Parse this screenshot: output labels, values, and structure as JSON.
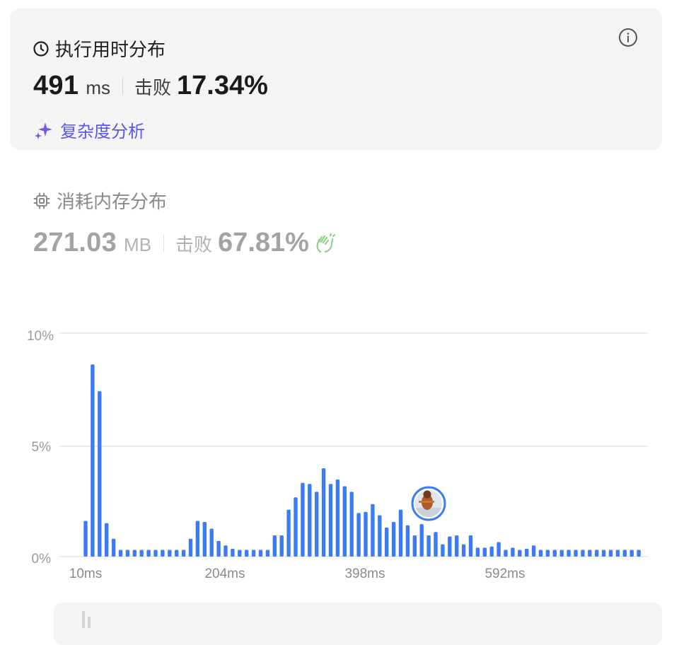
{
  "runtime": {
    "title": "执行用时分布",
    "value": "491",
    "unit": "ms",
    "beat_label": "击败",
    "beat_value": "17.34%",
    "complexity_link": "复杂度分析"
  },
  "memory": {
    "title": "消耗内存分布",
    "value": "271.03",
    "unit": "MB",
    "beat_label": "击败",
    "beat_value": "67.81%"
  },
  "colors": {
    "bar": "#3b7cf6",
    "accent_link": "#5b56e8",
    "card_bg": "#f4f4f5"
  },
  "chart_data": {
    "type": "bar",
    "y_ticks": [
      "10%",
      "5%",
      "0%"
    ],
    "x_ticks": [
      "10ms",
      "204ms",
      "398ms",
      "592ms"
    ],
    "ylim": [
      0,
      10
    ],
    "grid": true,
    "highlight_marker": "avatar at 491ms",
    "values": [
      1.6,
      8.6,
      7.4,
      1.5,
      0.8,
      0.3,
      0.3,
      0.3,
      0.3,
      0.3,
      0.3,
      0.3,
      0.3,
      0.3,
      0.3,
      0.8,
      1.6,
      1.55,
      1.25,
      0.7,
      0.5,
      0.35,
      0.3,
      0.3,
      0.3,
      0.3,
      0.3,
      0.95,
      0.95,
      2.1,
      2.65,
      3.3,
      3.25,
      2.9,
      3.95,
      3.25,
      3.45,
      3.15,
      2.9,
      1.95,
      2.0,
      2.35,
      1.85,
      1.3,
      1.55,
      2.1,
      1.4,
      0.95,
      1.45,
      0.95,
      1.1,
      0.55,
      0.9,
      0.95,
      0.55,
      0.95,
      0.4,
      0.4,
      0.45,
      0.65,
      0.3,
      0.4,
      0.3,
      0.35,
      0.5,
      0.3,
      0.3,
      0.3,
      0.3,
      0.3,
      0.3,
      0.3,
      0.3,
      0.3,
      0.3,
      0.3,
      0.3,
      0.3,
      0.3,
      0.3
    ]
  }
}
